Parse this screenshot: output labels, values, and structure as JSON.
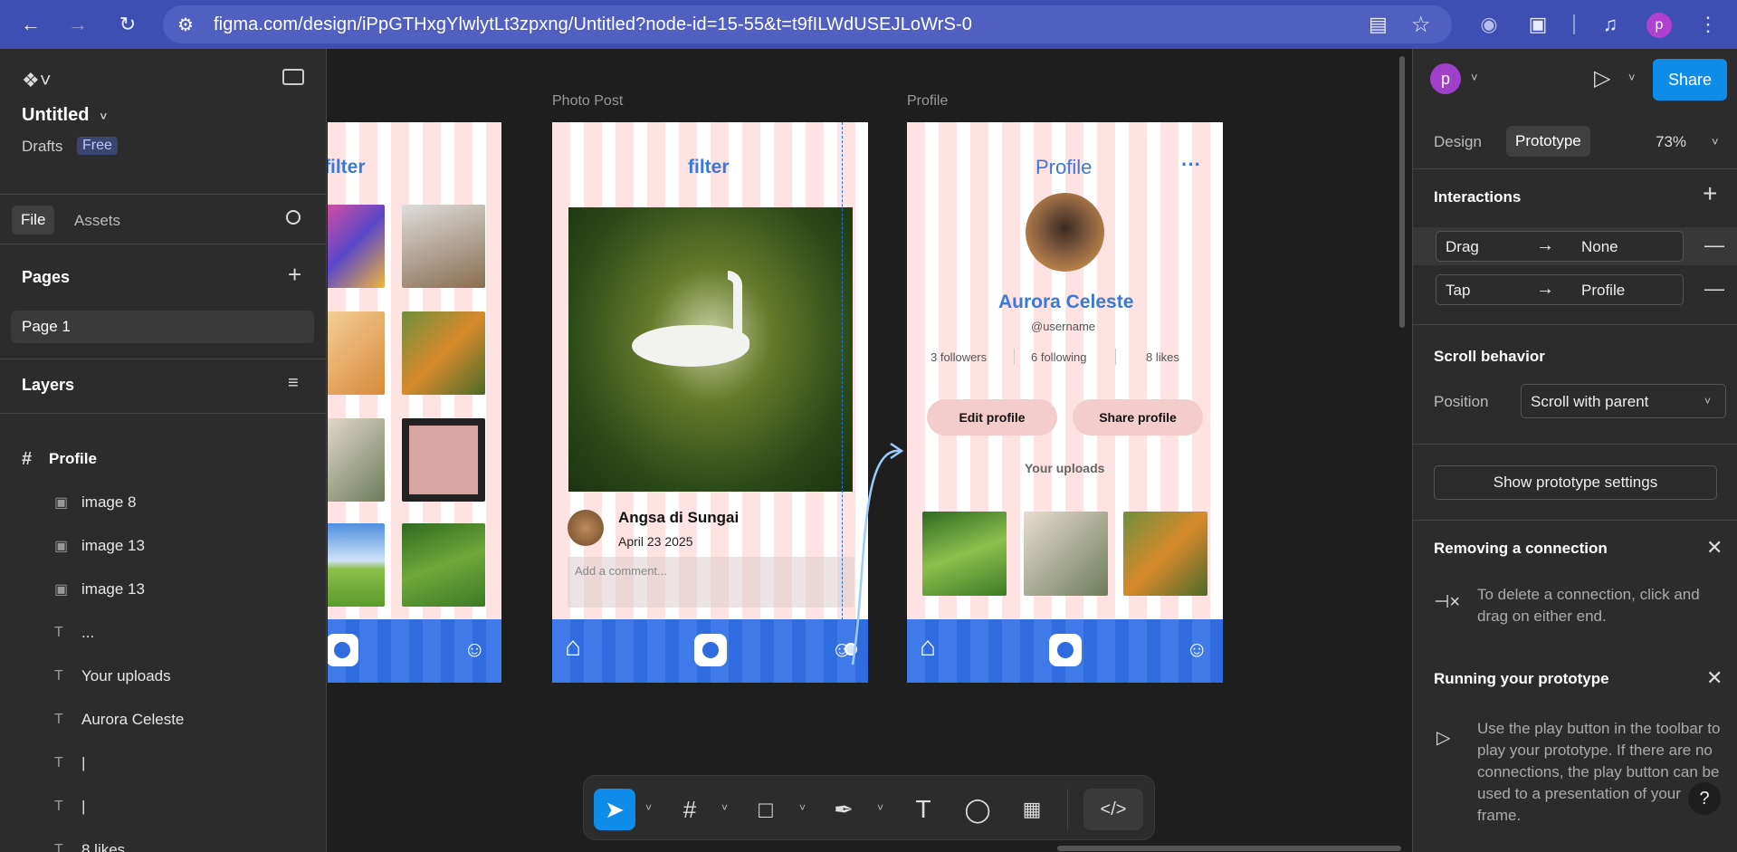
{
  "browser": {
    "url": "figma.com/design/iPpGTHxgYlwlytLt3zpxng/Untitled?node-id=15-55&t=t9fILWdUSEJLoWrS-0",
    "avatar": "p"
  },
  "left_panel": {
    "file_name": "Untitled",
    "drafts": "Drafts",
    "plan": "Free",
    "tabs": [
      "File",
      "Assets"
    ],
    "pages_title": "Pages",
    "pages": [
      "Page 1"
    ],
    "layers_title": "Layers",
    "layers": [
      {
        "icon": "frame",
        "name": "Profile"
      },
      {
        "icon": "image",
        "name": "image 8"
      },
      {
        "icon": "image",
        "name": "image 13"
      },
      {
        "icon": "image",
        "name": "image 13"
      },
      {
        "icon": "text",
        "name": "..."
      },
      {
        "icon": "text",
        "name": "Your uploads"
      },
      {
        "icon": "text",
        "name": "Aurora Celeste"
      },
      {
        "icon": "text",
        "name": "|"
      },
      {
        "icon": "text",
        "name": "|"
      },
      {
        "icon": "text",
        "name": "8 likes"
      }
    ]
  },
  "canvas": {
    "frames": [
      {
        "label": "Photo Post",
        "title": "filter",
        "post_title": "Angsa di Sungai",
        "post_date": "April 23 2025",
        "comment_placeholder": "Add a comment..."
      },
      {
        "label": "Profile",
        "title": "Profile",
        "more": "···",
        "user_name": "Aurora Celeste",
        "username": "@username",
        "stats": [
          "3 followers",
          "6 following",
          "8 likes"
        ],
        "edit_button": "Edit profile",
        "share_button": "Share profile",
        "uploads_label": "Your uploads"
      }
    ],
    "partial_frame_title": "filter"
  },
  "right_panel": {
    "avatar": "p",
    "share": "Share",
    "tabs": [
      "Design",
      "Prototype"
    ],
    "zoom": "73%",
    "interactions_title": "Interactions",
    "interactions": [
      {
        "trigger": "Drag",
        "action": "None"
      },
      {
        "trigger": "Tap",
        "action": "Profile"
      }
    ],
    "scroll_title": "Scroll behavior",
    "position_label": "Position",
    "position_value": "Scroll with parent",
    "show_settings": "Show prototype settings",
    "removing_title": "Removing a connection",
    "removing_text": "To delete a connection, click and drag on either end.",
    "running_title": "Running your prototype",
    "running_text": "Use the play button in the toolbar to play your prototype. If there are no connections, the play button can be used to a presentation of your frame."
  },
  "help": "?"
}
